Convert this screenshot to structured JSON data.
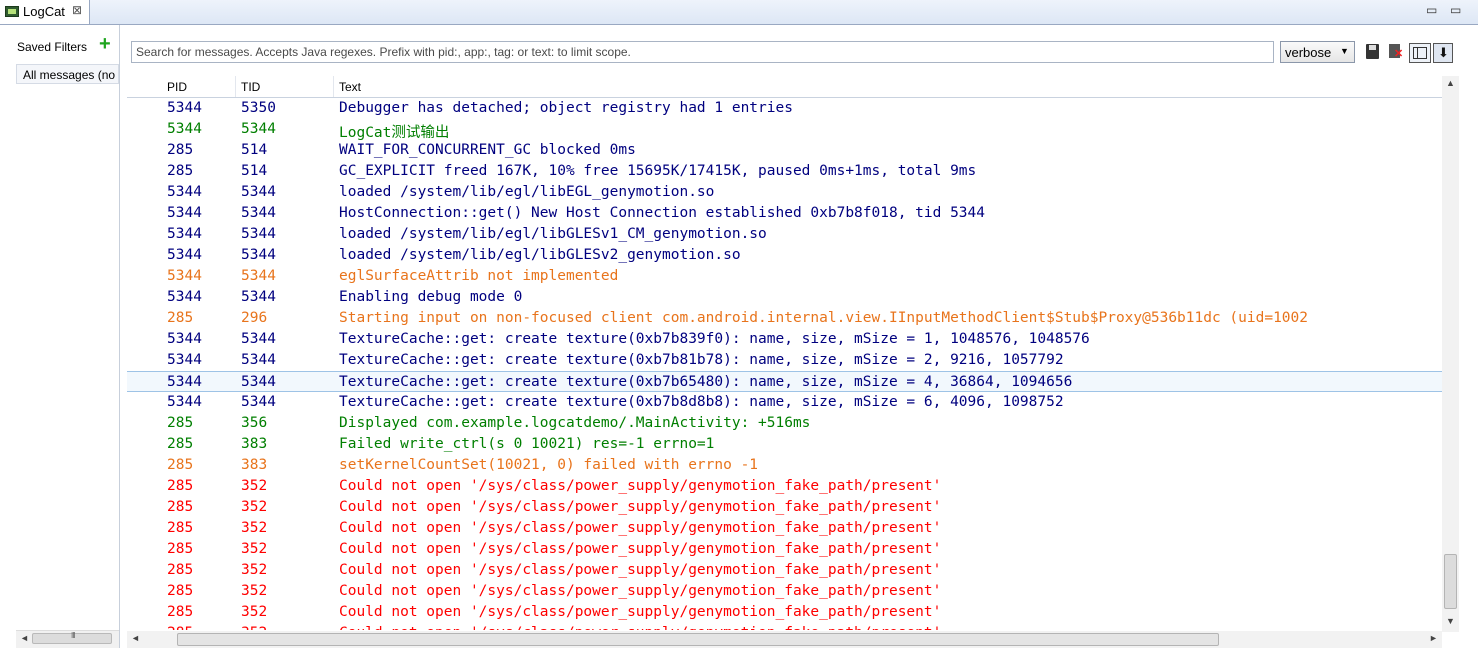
{
  "window": {
    "tab_label": "LogCat",
    "tab_close": "⊠",
    "minimize": "▭",
    "maximize": "▭"
  },
  "filters": {
    "title": "Saved Filters",
    "add_icon": "+",
    "items": [
      {
        "label": "All messages (no filters)"
      }
    ]
  },
  "toolbar": {
    "search_placeholder": "Search for messages. Accepts Java regexes. Prefix with pid:, app:, tag: or text: to limit scope.",
    "search_value": "",
    "log_level": "verbose",
    "icons": [
      "save-icon",
      "clear-log-icon",
      "toggle-panel-icon",
      "scroll-lock-icon"
    ]
  },
  "table": {
    "columns": [
      "PID",
      "TID",
      "Text"
    ],
    "selected_row": 13,
    "rows": [
      {
        "pid": "5344",
        "tid": "5350",
        "text": "Debugger has detached; object registry had 1 entries",
        "level": "D"
      },
      {
        "pid": "5344",
        "tid": "5344",
        "text": "LogCat测试输出",
        "level": "I"
      },
      {
        "pid": "285",
        "tid": "514",
        "text": "WAIT_FOR_CONCURRENT_GC blocked 0ms",
        "level": "D"
      },
      {
        "pid": "285",
        "tid": "514",
        "text": "GC_EXPLICIT freed 167K, 10% free 15695K/17415K, paused 0ms+1ms, total 9ms",
        "level": "D"
      },
      {
        "pid": "5344",
        "tid": "5344",
        "text": "loaded /system/lib/egl/libEGL_genymotion.so",
        "level": "D"
      },
      {
        "pid": "5344",
        "tid": "5344",
        "text": "HostConnection::get() New Host Connection established 0xb7b8f018, tid 5344",
        "level": "D"
      },
      {
        "pid": "5344",
        "tid": "5344",
        "text": "loaded /system/lib/egl/libGLESv1_CM_genymotion.so",
        "level": "D"
      },
      {
        "pid": "5344",
        "tid": "5344",
        "text": "loaded /system/lib/egl/libGLESv2_genymotion.so",
        "level": "D"
      },
      {
        "pid": "5344",
        "tid": "5344",
        "text": "eglSurfaceAttrib not implemented",
        "level": "W"
      },
      {
        "pid": "5344",
        "tid": "5344",
        "text": "Enabling debug mode 0",
        "level": "D"
      },
      {
        "pid": "285",
        "tid": "296",
        "text": "Starting input on non-focused client com.android.internal.view.IInputMethodClient$Stub$Proxy@536b11dc (uid=1002",
        "level": "W"
      },
      {
        "pid": "5344",
        "tid": "5344",
        "text": "TextureCache::get: create texture(0xb7b839f0): name, size, mSize = 1, 1048576, 1048576",
        "level": "D"
      },
      {
        "pid": "5344",
        "tid": "5344",
        "text": "TextureCache::get: create texture(0xb7b81b78): name, size, mSize = 2, 9216, 1057792",
        "level": "D"
      },
      {
        "pid": "5344",
        "tid": "5344",
        "text": "TextureCache::get: create texture(0xb7b65480): name, size, mSize = 4, 36864, 1094656",
        "level": "D"
      },
      {
        "pid": "5344",
        "tid": "5344",
        "text": "TextureCache::get: create texture(0xb7b8d8b8): name, size, mSize = 6, 4096, 1098752",
        "level": "D"
      },
      {
        "pid": "285",
        "tid": "356",
        "text": "Displayed com.example.logcatdemo/.MainActivity: +516ms",
        "level": "I"
      },
      {
        "pid": "285",
        "tid": "383",
        "text": "Failed write_ctrl(s 0 10021) res=-1 errno=1",
        "level": "I"
      },
      {
        "pid": "285",
        "tid": "383",
        "text": "setKernelCountSet(10021, 0) failed with errno -1",
        "level": "W"
      },
      {
        "pid": "285",
        "tid": "352",
        "text": "Could not open '/sys/class/power_supply/genymotion_fake_path/present'",
        "level": "E"
      },
      {
        "pid": "285",
        "tid": "352",
        "text": "Could not open '/sys/class/power_supply/genymotion_fake_path/present'",
        "level": "E"
      },
      {
        "pid": "285",
        "tid": "352",
        "text": "Could not open '/sys/class/power_supply/genymotion_fake_path/present'",
        "level": "E"
      },
      {
        "pid": "285",
        "tid": "352",
        "text": "Could not open '/sys/class/power_supply/genymotion_fake_path/present'",
        "level": "E"
      },
      {
        "pid": "285",
        "tid": "352",
        "text": "Could not open '/sys/class/power_supply/genymotion_fake_path/present'",
        "level": "E"
      },
      {
        "pid": "285",
        "tid": "352",
        "text": "Could not open '/sys/class/power_supply/genymotion_fake_path/present'",
        "level": "E"
      },
      {
        "pid": "285",
        "tid": "352",
        "text": "Could not open '/sys/class/power_supply/genymotion_fake_path/present'",
        "level": "E"
      },
      {
        "pid": "285",
        "tid": "352",
        "text": "Could not open '/sys/class/power_supply/genymotion_fake_path/present'",
        "level": "E"
      }
    ]
  },
  "scrollbars": {
    "up_arrow": "▲",
    "down_arrow": "▼",
    "left_arrow": "◄",
    "right_arrow": "►",
    "grip": "III"
  },
  "colors": {
    "debug": "#00007f",
    "info": "#007f00",
    "warn": "#e8741c",
    "error": "#ff0000",
    "verbose": "#000000",
    "selection": "#f2f8fd"
  }
}
